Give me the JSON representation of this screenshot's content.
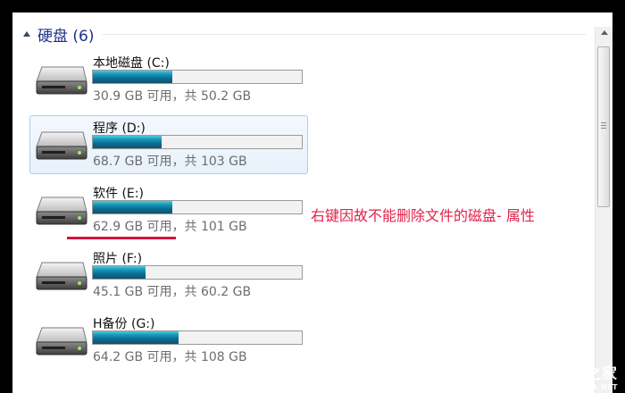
{
  "group": {
    "title": "硬盘 (6)"
  },
  "drives": [
    {
      "name": "本地磁盘 (C:)",
      "size_text": "30.9 GB 可用，共 50.2 GB",
      "used_fraction": 0.38,
      "selected": false
    },
    {
      "name": "程序 (D:)",
      "size_text": "68.7 GB 可用，共 103 GB",
      "used_fraction": 0.33,
      "selected": true
    },
    {
      "name": "软件 (E:)",
      "size_text": "62.9 GB 可用，共 101 GB",
      "used_fraction": 0.38,
      "selected": false
    },
    {
      "name": "照片 (F:)",
      "size_text": "45.1 GB 可用，共 60.2 GB",
      "used_fraction": 0.25,
      "selected": false
    },
    {
      "name": "H备份 (G:)",
      "size_text": "64.2 GB 可用，共 108 GB",
      "used_fraction": 0.41,
      "selected": false
    }
  ],
  "annotation": {
    "text": "右键因故不能删除文件的磁盘- 属性"
  },
  "watermark": {
    "main": "系统之家",
    "url": "XITONGZHIJIA.NET"
  },
  "icons": {
    "drive": "hard-drive-icon",
    "collapse": "collapse-arrow-icon",
    "scroll_up": "scroll-up-arrow-icon"
  },
  "colors": {
    "accent": "#1e3287",
    "annotation": "#e0224a",
    "bar": "#0a6f95"
  }
}
